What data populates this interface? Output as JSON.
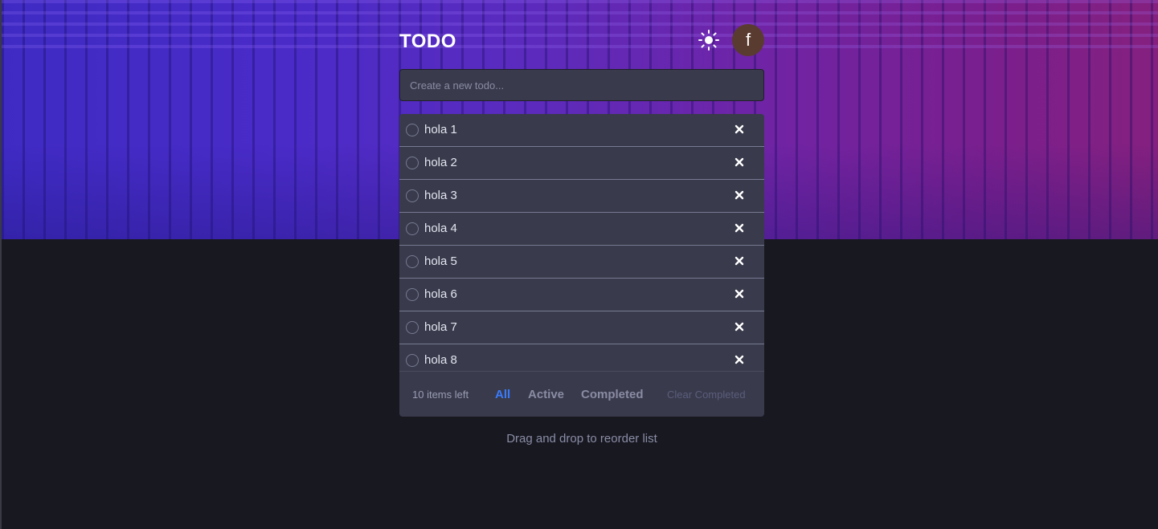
{
  "header": {
    "title": "TODO",
    "avatar_letter": "f",
    "theme_icon": "sun-icon"
  },
  "new_todo": {
    "placeholder": "Create a new todo..."
  },
  "todos": [
    {
      "label": "hola 1",
      "completed": false
    },
    {
      "label": "hola 2",
      "completed": false
    },
    {
      "label": "hola 3",
      "completed": false
    },
    {
      "label": "hola 4",
      "completed": false
    },
    {
      "label": "hola 5",
      "completed": false
    },
    {
      "label": "hola 6",
      "completed": false
    },
    {
      "label": "hola 7",
      "completed": false
    },
    {
      "label": "hola 8",
      "completed": false
    }
  ],
  "footer": {
    "items_left": "10 items left",
    "filters": [
      "All",
      "Active",
      "Completed"
    ],
    "active_filter": "All",
    "clear_label": "Clear Completed"
  },
  "hint": "Drag and drop to reorder list",
  "colors": {
    "accent": "#3a7bfd",
    "card": "#393a4b",
    "background": "#181821"
  }
}
